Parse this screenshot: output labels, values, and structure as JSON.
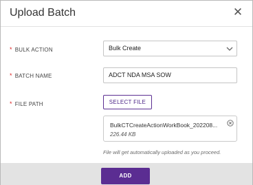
{
  "dialog": {
    "title": "Upload Batch",
    "close_icon": "close-icon"
  },
  "form": {
    "bulk_action": {
      "label": "BULK ACTION",
      "required_mark": "*",
      "value": "Bulk Create",
      "icon": "chevron-down-icon"
    },
    "batch_name": {
      "label": "BATCH NAME",
      "required_mark": "*",
      "value": "ADCT NDA MSA SOW"
    },
    "file_path": {
      "label": "FILE PATH",
      "required_mark": "*",
      "button_label": "SELECT FILE",
      "file": {
        "name": "BulkCTCreateActionWorkBook_202208...",
        "size": "226.44 KB",
        "remove_icon": "remove-circle-icon"
      },
      "hint": "File will get automatically uploaded as you proceed."
    }
  },
  "footer": {
    "add_label": "ADD"
  },
  "colors": {
    "accent": "#5b2d92",
    "required": "#dd2222",
    "footer_bg": "#e3e3e3"
  }
}
